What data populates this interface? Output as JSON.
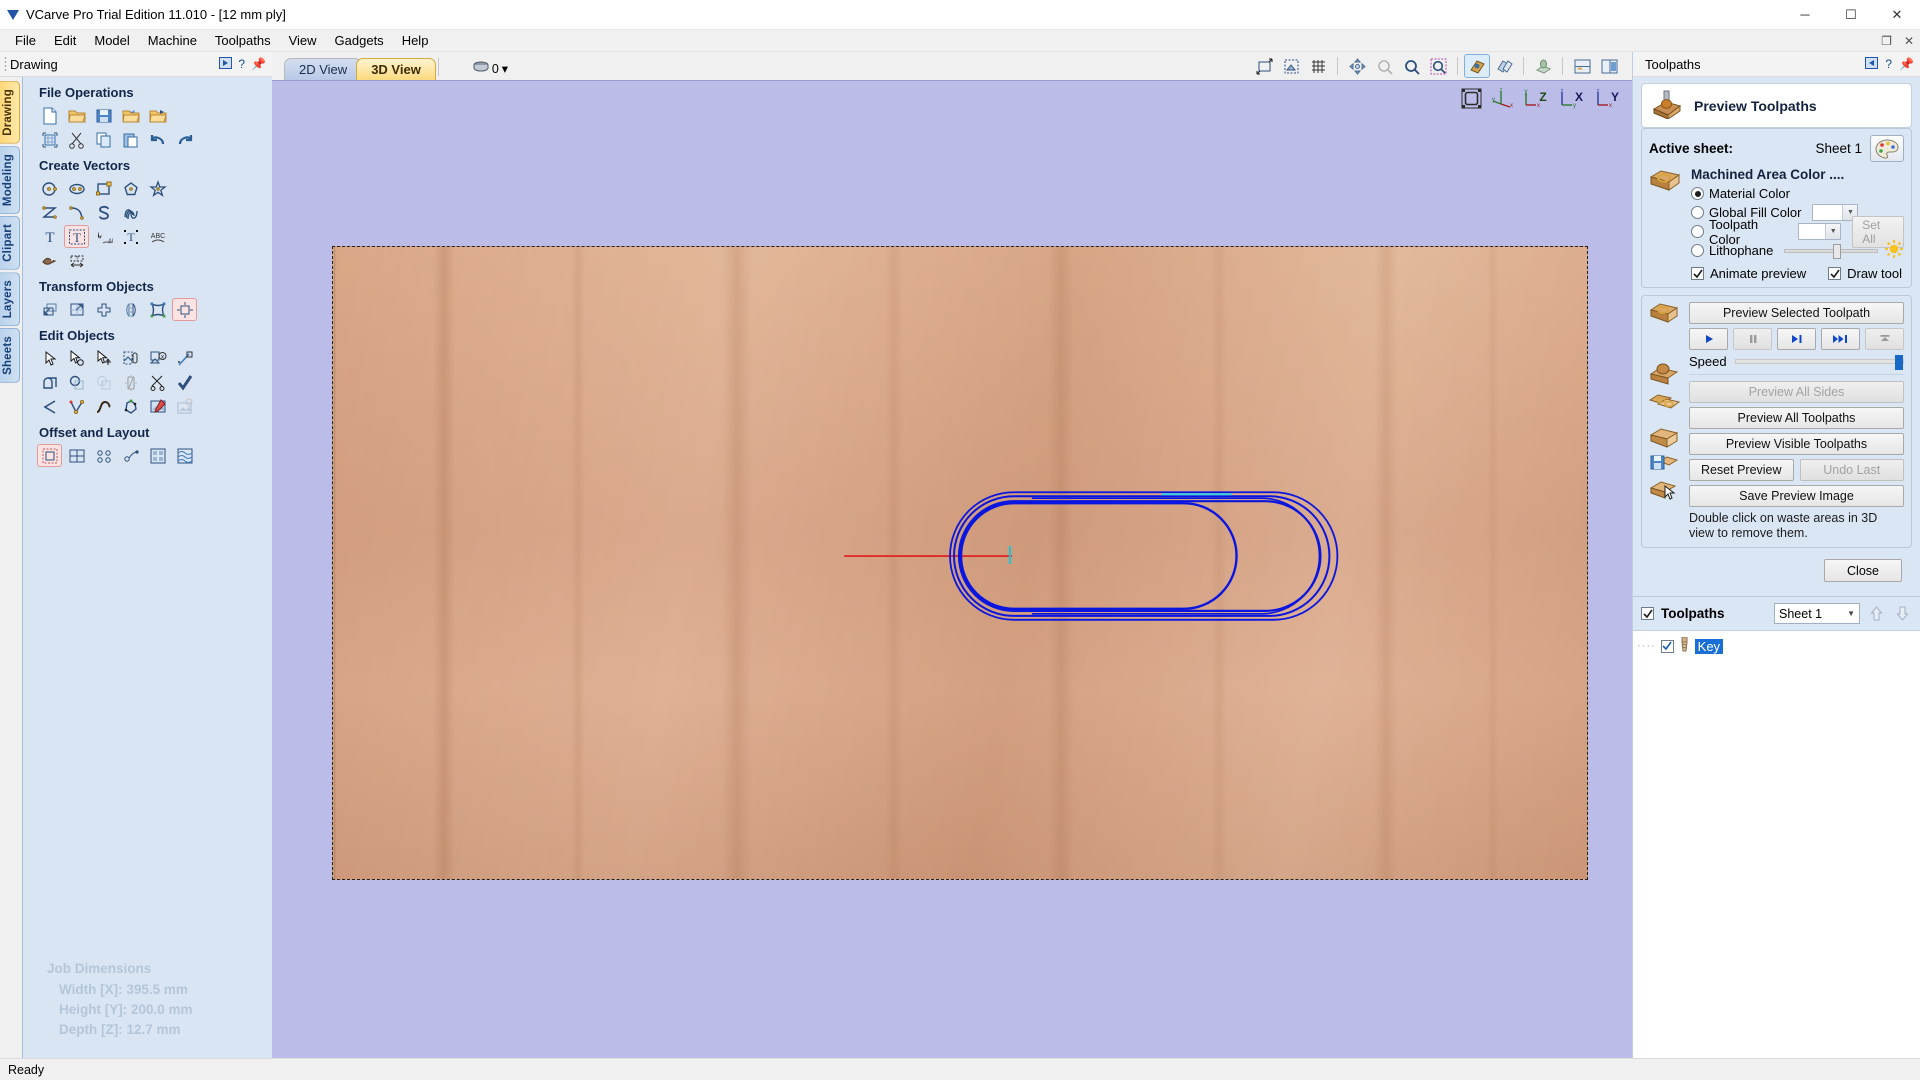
{
  "window": {
    "title": "VCarve Pro Trial Edition 11.010 - [12 mm ply]",
    "minimize": "─",
    "maximize": "☐",
    "close": "✕",
    "restore_down": "❐",
    "inner_close": "✕"
  },
  "menu": {
    "items": [
      "File",
      "Edit",
      "Model",
      "Machine",
      "Toolpaths",
      "View",
      "Gadgets",
      "Help"
    ]
  },
  "left_panel": {
    "header": "Drawing",
    "tabs": [
      "Drawing",
      "Modeling",
      "Clipart",
      "Layers",
      "Sheets"
    ],
    "active_tab": "Drawing",
    "groups": [
      {
        "title": "File Operations",
        "rows": [
          [
            "new-file-icon",
            "open-file-icon",
            "save-file-icon",
            "open-recent-icon",
            "import-vectors-icon"
          ],
          [
            "job-setup-icon",
            "cut-icon",
            "copy-icon",
            "paste-icon",
            "undo-icon",
            "redo-icon"
          ]
        ]
      },
      {
        "title": "Create Vectors",
        "rows": [
          [
            "draw-circle-icon",
            "draw-ellipse-icon",
            "draw-rectangle-icon",
            "draw-polygon-icon",
            "draw-star-icon"
          ],
          [
            "draw-polyline-icon",
            "draw-curve-icon",
            "draw-spiral-icon",
            "draw-weave-icon"
          ],
          [
            "create-text-icon",
            "edit-text-icon",
            "text-on-curve-icon",
            "auto-layout-text-icon",
            "text-arc-icon"
          ],
          [
            "trace-bitmap-icon",
            "dimension-icon"
          ]
        ]
      },
      {
        "title": "Transform Objects",
        "rows": [
          [
            "move-icon",
            "scale-icon",
            "rotate-icon",
            "mirror-icon",
            "distort-icon",
            "align-icon"
          ]
        ]
      },
      {
        "title": "Edit Objects",
        "rows": [
          [
            "select-icon",
            "node-edit-icon",
            "move-nodes-icon",
            "join-vectors-icon",
            "close-vector-icon",
            "measure-icon"
          ],
          [
            "weld-icon",
            "subtract-icon",
            "trim-icon",
            "fillet-icon",
            "trim-tool-icon",
            "check-geometry-icon"
          ],
          [
            "curve-fit-icon",
            "node-tools-icon",
            "smooth-icon",
            "nest-icon",
            "edit-bitmap-icon",
            "crop-bitmap-icon"
          ]
        ]
      },
      {
        "title": "Offset and Layout",
        "rows": [
          [
            "offset-icon",
            "array-copy-icon",
            "block-copy-icon",
            "rotate-copy-icon",
            "nesting-icon",
            "texture-icon"
          ]
        ]
      }
    ],
    "job_dimensions": {
      "title": "Job Dimensions",
      "width": "Width  [X]: 395.5 mm",
      "height": "Height [Y]: 200.0 mm",
      "depth": "Depth  [Z]: 12.7 mm"
    }
  },
  "view_bar": {
    "tabs": [
      {
        "label": "2D View",
        "active": false
      },
      {
        "label": "3D View",
        "active": true
      }
    ],
    "sheet_index": "0",
    "sheet_dropdown_arrow": "▾",
    "icons": [
      {
        "name": "zoom-to-fit-icon",
        "on": false
      },
      {
        "name": "zoom-to-selection-icon",
        "on": false
      },
      {
        "name": "toggle-grid-icon",
        "on": false
      },
      {
        "name": "pan-icon",
        "on": false
      },
      {
        "name": "zoom-out-icon",
        "on": false
      },
      {
        "name": "zoom-in-icon",
        "on": false
      },
      {
        "name": "zoom-box-icon",
        "on": false
      },
      {
        "name": "shade-model-icon",
        "on": true
      },
      {
        "name": "show-toolpaths-icon",
        "on": false
      },
      {
        "name": "lighting-icon",
        "on": false
      },
      {
        "name": "two-view-split-icon",
        "on": false
      },
      {
        "name": "side-by-side-view-icon",
        "on": false
      }
    ]
  },
  "canvas": {
    "corner_icons": [
      {
        "name": "isometric-view-icon",
        "label": ""
      },
      {
        "name": "axis-indicator-icon",
        "label": ""
      },
      {
        "name": "top-z-view-icon",
        "label": "Z"
      },
      {
        "name": "front-x-view-icon",
        "label": "X"
      },
      {
        "name": "side-y-view-icon",
        "label": "Y"
      }
    ],
    "material_color": "#d9a98b",
    "toolpath_color": "#0a16e0",
    "rapid_move_color": "#e01a1a"
  },
  "right_panel": {
    "header": "Toolpaths",
    "preview_title": "Preview Toolpaths",
    "active_sheet_label": "Active sheet:",
    "active_sheet_value": "Sheet 1",
    "machined_area_title": "Machined Area Color ....",
    "color_options": [
      {
        "label": "Material Color",
        "selected": true,
        "has_dropdown": false
      },
      {
        "label": "Global Fill Color",
        "selected": false,
        "has_dropdown": true
      },
      {
        "label": "Toolpath Color",
        "selected": false,
        "has_dropdown": true
      },
      {
        "label": "Lithophane",
        "selected": false,
        "has_dropdown": false
      }
    ],
    "set_all_label": "Set All",
    "checkboxes": [
      {
        "label": "Animate preview",
        "checked": true
      },
      {
        "label": "Draw tool",
        "checked": true
      }
    ],
    "preview_selected": "Preview Selected Toolpath",
    "transport": [
      {
        "name": "play-button",
        "glyph": "▶",
        "disabled": false
      },
      {
        "name": "pause-button",
        "glyph": "❙❙",
        "disabled": true
      },
      {
        "name": "step-button",
        "glyph": "▶❙",
        "disabled": false
      },
      {
        "name": "fast-forward-button",
        "glyph": "▶▶❙",
        "disabled": false
      },
      {
        "name": "skip-to-end-button",
        "glyph": "⏫",
        "disabled": true
      }
    ],
    "speed_label": "Speed",
    "preview_all_sides": "Preview All Sides",
    "preview_all_toolpaths": "Preview All Toolpaths",
    "preview_visible_toolpaths": "Preview Visible Toolpaths",
    "reset_preview": "Reset Preview",
    "undo_last": "Undo Last",
    "save_preview_image": "Save Preview Image",
    "hint_text": "Double click on waste areas in 3D view to remove them.",
    "close_label": "Close"
  },
  "toolpath_list": {
    "title": "Toolpaths",
    "checked": true,
    "sheet_value": "Sheet 1",
    "items": [
      {
        "name": "Key",
        "checked": true,
        "selected": true
      }
    ]
  },
  "status_bar": {
    "text": "Ready"
  }
}
